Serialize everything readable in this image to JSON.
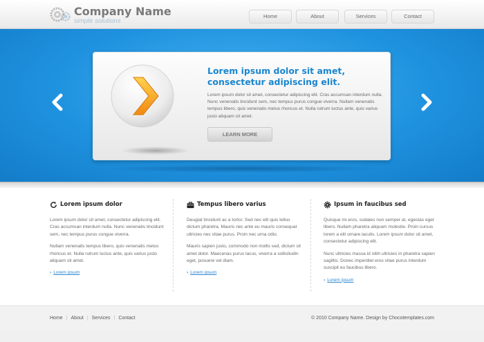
{
  "brand": {
    "name": "Company Name",
    "tagline": "simple solutions",
    "logo_icon": "gears-icon"
  },
  "nav": {
    "items": [
      {
        "label": "Home"
      },
      {
        "label": "About"
      },
      {
        "label": "Services"
      },
      {
        "label": "Contact"
      }
    ]
  },
  "slider": {
    "prev_icon": "chevron-left-icon",
    "next_icon": "chevron-right-icon",
    "image_icon": "orange-arrow-orb-icon",
    "title": "Lorem ipsum dolor sit amet, consectetur adipiscing elit.",
    "text": "Lorem ipsum dolor sit amet, consectetur adipiscing elit. Cras accumsan interdum nulla. Nunc venenatis tincidunt sem, nec tempus purus congue viverra. Nullam venenatis tempus libero, quis venenatis metus rhoncus et. Nulla rutrum luctus ante, quis varius justo aliquam sit amet.",
    "button_label": "LEARN MORE"
  },
  "columns": [
    {
      "icon": "refresh-icon",
      "title": "Lorem ipsum dolor",
      "p1": "Lorem ipsum dolor sit amet, consectetur adipiscing elit. Cras accumsan interdum nulla. Nunc venenatis tincidunt sem, nec tempus purus congue viverra.",
      "p2": "Nullam venenatis tempus libero, quis venenatis metus rhoncus et. Nulla rutrum luctus ante, quis varius justo aliquam sit amet.",
      "link": "Lorem ipsum"
    },
    {
      "icon": "briefcase-icon",
      "title": "Tempus libero varius",
      "p1": "Deugiat tincidunt ac a tortor. Sed nec elit quis tellus dictum pharetra. Mauris nec ante eu mauris consequat ultricies nec vitae purus. Proin nec urna odio.",
      "p2": "Mauris sapien justo, commodo non mollis sed, dictum sit amet dolor. Maecenas purus lacus, viverra a sollicitudin eget, posuere vel diam.",
      "link": "Lorem ipsum"
    },
    {
      "icon": "gear-icon",
      "title": "Ipsum in faucibus sed",
      "p1": "Quisque mi eros, sodales non semper at, egestas eget libero. Nullam pharetra aliquam molestie. Proin cursus lorem a elit ornare iaculis. Lorem ipsum dolor sit amet, consectetur adipiscing elit.",
      "p2": "Nunc ultricies massa id nibh ultricies in pharetra sapien sagittis. Donec imperdiet eros vitae purus interdum suscipit eu faucibus libero.",
      "link": "Lorem ipsum"
    }
  ],
  "footer": {
    "links": [
      {
        "label": "Home"
      },
      {
        "label": "About"
      },
      {
        "label": "Services"
      },
      {
        "label": "Contact"
      }
    ],
    "copyright": "© 2010 Company Name. Design by Chocotemplates.com"
  },
  "colors": {
    "hero_blue": "#1f92df",
    "accent_blue": "#1a86cf",
    "orb_orange": "#f5a623"
  }
}
